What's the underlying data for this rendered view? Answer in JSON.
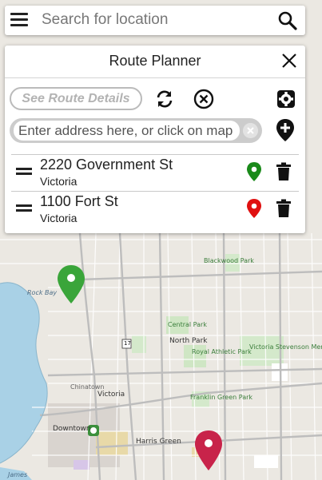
{
  "search": {
    "placeholder": "Search for location"
  },
  "route_planner": {
    "title": "Route Planner",
    "see_details_label": "See Route Details",
    "address_placeholder": "Enter address here, or click on map",
    "stops": [
      {
        "address": "2220 Government St",
        "city": "Victoria",
        "pin_color": "#1a8a1a"
      },
      {
        "address": "1100 Fort St",
        "city": "Victoria",
        "pin_color": "#e01010"
      }
    ]
  },
  "map": {
    "labels": {
      "rock_bay": "Rock Bay",
      "victoria": "Victoria",
      "downtown": "Downtown",
      "harris_green": "Harris Green",
      "north_park": "North Park",
      "central_park": "Central Park",
      "royal_athletic_park": "Royal Athletic Park",
      "stevenson": "Victoria Stevenson Memorial Park",
      "blackwood": "Blackwood Park",
      "franklin_green": "Franklin Green Park",
      "chinatown": "Chinatown",
      "highway": "17",
      "james": "James"
    },
    "markers": [
      {
        "name": "start",
        "color": "#3aa53a"
      },
      {
        "name": "end",
        "color": "#c8234a"
      }
    ]
  }
}
